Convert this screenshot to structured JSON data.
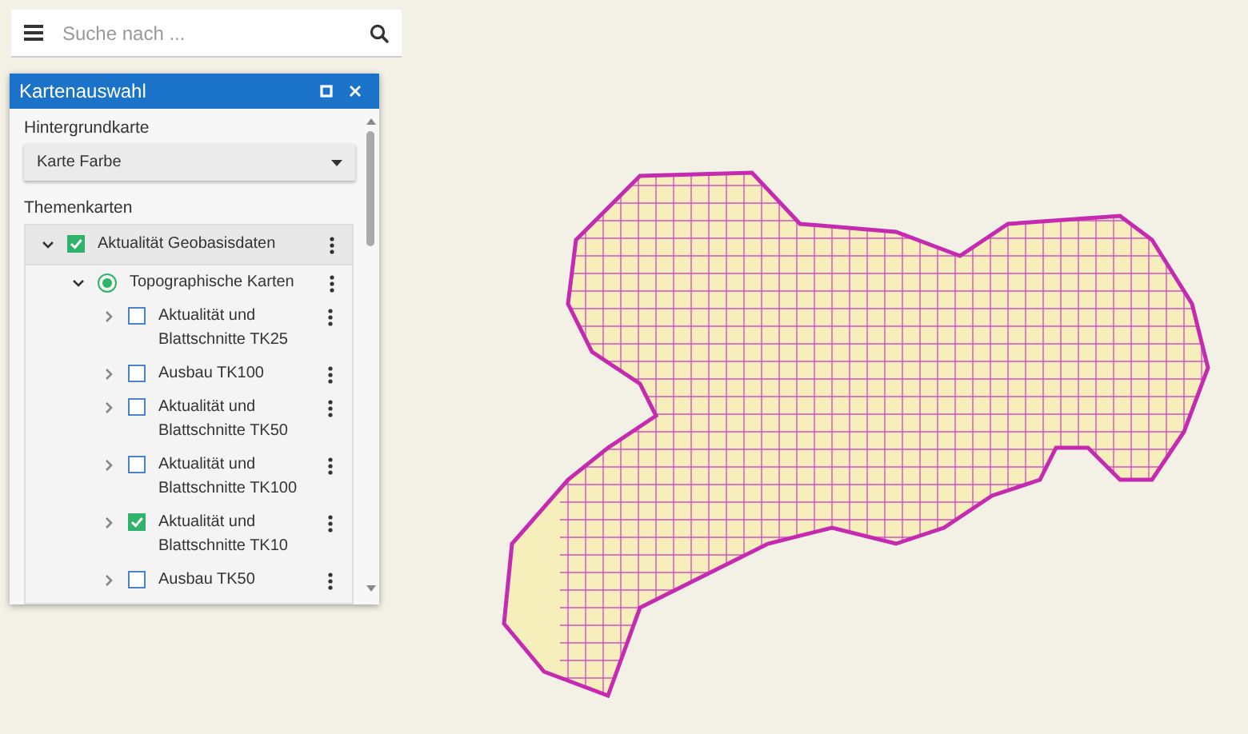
{
  "search": {
    "placeholder": "Suche nach ..."
  },
  "panel": {
    "title": "Kartenauswahl",
    "background_label": "Hintergrundkarte",
    "background_select": {
      "value": "Karte Farbe"
    },
    "themes_label": "Themenkarten",
    "tree": [
      {
        "label": "Aktualität Geobasisdaten",
        "kind": "checkbox",
        "checked": true,
        "expanded": true,
        "children": [
          {
            "label": "Topographische Karten",
            "kind": "radio",
            "checked": true,
            "expanded": true,
            "children": [
              {
                "label": "Aktualität und Blattschnitte TK25",
                "kind": "checkbox",
                "checked": false,
                "expanded": false
              },
              {
                "label": "Ausbau TK100",
                "kind": "checkbox",
                "checked": false,
                "expanded": false
              },
              {
                "label": "Aktualität und Blattschnitte TK50",
                "kind": "checkbox",
                "checked": false,
                "expanded": false
              },
              {
                "label": "Aktualität und Blattschnitte TK100",
                "kind": "checkbox",
                "checked": false,
                "expanded": false
              },
              {
                "label": "Aktualität und Blattschnitte TK10",
                "kind": "checkbox",
                "checked": true,
                "expanded": false
              },
              {
                "label": "Ausbau TK50",
                "kind": "checkbox",
                "checked": false,
                "expanded": false
              }
            ]
          }
        ]
      }
    ]
  }
}
